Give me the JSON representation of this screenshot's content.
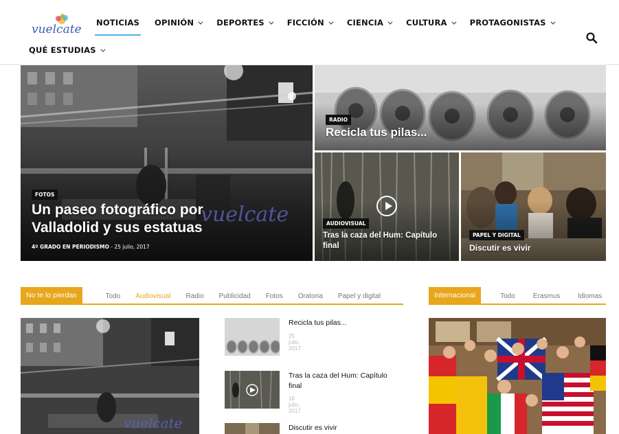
{
  "header": {
    "logo_text": "vuelcate",
    "nav": [
      {
        "label": "NOTICIAS",
        "active": true,
        "dropdown": false
      },
      {
        "label": "OPINIÓN",
        "active": false,
        "dropdown": true
      },
      {
        "label": "DEPORTES",
        "active": false,
        "dropdown": true
      },
      {
        "label": "FICCIÓN",
        "active": false,
        "dropdown": true
      },
      {
        "label": "CIENCIA",
        "active": false,
        "dropdown": true
      },
      {
        "label": "CULTURA",
        "active": false,
        "dropdown": true
      },
      {
        "label": "PROTAGONISTAS",
        "active": false,
        "dropdown": true
      }
    ],
    "nav_second_row": {
      "label": "QUÉ ESTUDIAS",
      "dropdown": true
    },
    "search_icon": "search-icon"
  },
  "hero": {
    "main": {
      "tag": "FOTOS",
      "title_line1": "Un paseo fotográfico por",
      "title_line2": "Valladolid y sus estatuas",
      "author": "4º GRADO EN PERIODISMO",
      "date": "- 25 julio, 2017",
      "watermark": "vuelcate"
    },
    "top_right": {
      "tag": "RADIO",
      "title": "Recicla tus pilas..."
    },
    "bottom_left": {
      "tag": "AUDIOVISUAL",
      "title_line1": "Tras la caza del Hum: Capítulo",
      "title_line2": "final"
    },
    "bottom_right": {
      "tag": "PAPEL Y DIGITAL",
      "title": "Discutir es vivir"
    }
  },
  "block1": {
    "label": "No te lo pierdas",
    "filters": [
      "Todo",
      "Audiovisual",
      "Radio",
      "Publicidad",
      "Fotos",
      "Oratoria",
      "Papel y digital"
    ],
    "active_filter": "Audiovisual",
    "list": [
      {
        "title": "Recicla tus pilas...",
        "date": "25 julio, 2017"
      },
      {
        "title_line1": "Tras la caza del Hum: Capítulo",
        "title_line2": "final",
        "date": "18 julio, 2017"
      },
      {
        "title": "Discutir es vivir"
      }
    ]
  },
  "block2": {
    "label": "Internacional",
    "filters": [
      "Todo",
      "Erasmus",
      "Idiomas"
    ]
  },
  "colors": {
    "accent": "#e8a61c",
    "nav_active": "#4db2ec"
  }
}
